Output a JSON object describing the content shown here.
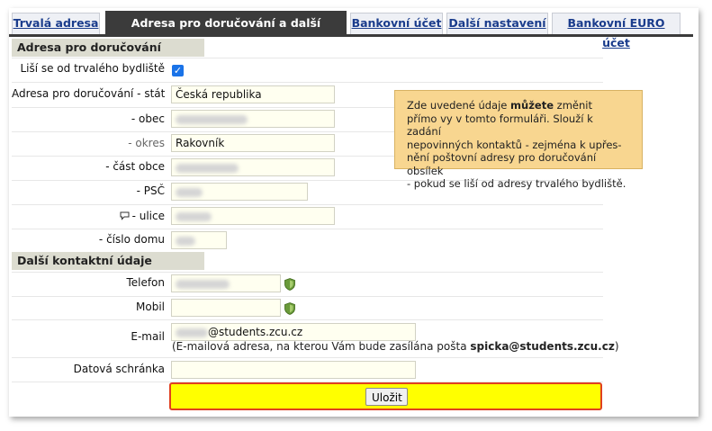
{
  "tabs": [
    {
      "label": "Trvalá adresa",
      "active": false
    },
    {
      "label": "Adresa pro doručování a další kontakty",
      "active": true
    },
    {
      "label": "Bankovní účet",
      "active": false
    },
    {
      "label": "Další nastavení",
      "active": false
    },
    {
      "label": "Bankovní EURO účet",
      "active": false
    }
  ],
  "sections": {
    "delivery": "Adresa pro doručování",
    "contacts": "Další kontaktní údaje"
  },
  "delivery": {
    "differs_label": "Liší se od trvalého bydliště",
    "differs_checked": true,
    "state_label": "Adresa pro doručování - stát",
    "state_value": "Česká republika",
    "city_label": "- obec",
    "district_label": "- okres",
    "district_value": "Rakovník",
    "part_label": "- část obce",
    "zip_label": "- PSČ",
    "street_label": "- ulice",
    "house_label": "- číslo domu"
  },
  "contacts": {
    "phone_label": "Telefon",
    "mobile_label": "Mobil",
    "email_label": "E-mail",
    "email_value_suffix": "@students.zcu.cz",
    "email_note_prefix": "(E-mailová adresa, na kterou Vám bude zasílána pošta ",
    "email_note_address": "spicka@students.zcu.cz",
    "email_note_suffix": ")",
    "databox_label": "Datová schránka"
  },
  "tooltip": {
    "line1_prefix": "Zde uvedené údaje ",
    "line1_bold": "můžete",
    "line1_suffix": " změnit",
    "line2": "přímo vy v tomto formuláři. Slouží k zadání",
    "line3": "nepovinných kontaktů - zejména k upřes-",
    "line4": "nění poštovní adresy pro doručování obsílek",
    "line5": "- pokud se liší od adresy trvalého bydliště."
  },
  "save_label": "Uložit",
  "icons": {
    "checkbox": "check-icon",
    "street": "chat-bubble-icon",
    "phone_verify": "shield-icon",
    "mobile_verify": "shield-icon"
  },
  "colors": {
    "tab_active_bg": "#3b3b3b",
    "tab_link": "#1a3c8c",
    "section_bg": "#dcdcd0",
    "input_bg": "#fffff0",
    "tooltip_bg": "#f8d690",
    "save_bar_bg": "#ffff00",
    "save_bar_border": "#e04020",
    "shield": "#6a9a3a"
  }
}
